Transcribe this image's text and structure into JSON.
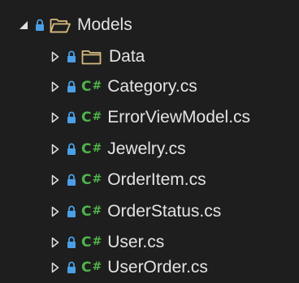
{
  "tree": {
    "root": {
      "label": "Models",
      "expanded": true,
      "icon": "folder-open-icon"
    },
    "children": [
      {
        "label": "Data",
        "type": "folder",
        "icon": "folder-icon"
      },
      {
        "label": "Category.cs",
        "type": "cs",
        "badge": "C#"
      },
      {
        "label": "ErrorViewModel.cs",
        "type": "cs",
        "badge": "C#"
      },
      {
        "label": "Jewelry.cs",
        "type": "cs",
        "badge": "C#"
      },
      {
        "label": "OrderItem.cs",
        "type": "cs",
        "badge": "C#"
      },
      {
        "label": "OrderStatus.cs",
        "type": "cs",
        "badge": "C#"
      },
      {
        "label": "User.cs",
        "type": "cs",
        "badge": "C#"
      },
      {
        "label": "UserOrder.cs",
        "type": "cs",
        "badge": "C#"
      }
    ]
  },
  "colors": {
    "background": "#1e1e1e",
    "text": "#e4e4e4",
    "lock": "#4a9fe6",
    "csharp": "#4fb44a",
    "folder": "#d7ba7d"
  }
}
